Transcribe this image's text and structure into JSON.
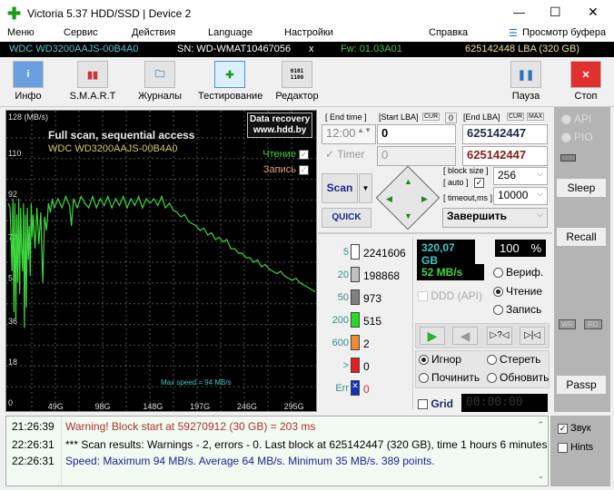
{
  "window": {
    "title": "Victoria 5.37 HDD/SSD | Device 2",
    "minimize": "—",
    "maximize": "☐",
    "close": "✕"
  },
  "menu": [
    "Меню",
    "Сервис",
    "Действия",
    "Language",
    "Настройки",
    "Справка"
  ],
  "buffer_view": "Просмотр буфера",
  "device": {
    "model": "WDC WD3200AAJS-00B4A0",
    "serial": "SN: WD-WMAT10467056",
    "x": "x",
    "firmware": "Fw: 01.03A01",
    "capacity": "625142448 LBA (320 GB)"
  },
  "toolbar": {
    "info": "Инфо",
    "smart": "S.M.A.R.T",
    "logs": "Журналы",
    "testing": "Тестирование",
    "editor": "Редактор",
    "pause": "Пауза",
    "stop": "Стоп"
  },
  "chart_data": {
    "type": "line",
    "title": "Full scan, sequential access",
    "subtitle": "WDC WD3200AAJS-00B4A0",
    "ylabel": "128 (MB/s)",
    "yticks": [
      "110",
      "92",
      "73",
      "55",
      "36",
      "18",
      "0"
    ],
    "xticks": [
      "49G",
      "98G",
      "148G",
      "197G",
      "246G",
      "295G"
    ],
    "ylim": [
      0,
      128
    ],
    "xlim": [
      0,
      320
    ],
    "grid": true,
    "badge": [
      "Data recovery",
      "www.hdd.by"
    ],
    "legend": [
      {
        "label": "Чтение",
        "checked": true,
        "color": "#3ed63e"
      },
      {
        "label": "Запись",
        "checked": true,
        "color": "#e0a080"
      }
    ],
    "annotation": "Max speed = 94 MB/s",
    "series": [
      {
        "name": "Чтение",
        "color": "#3ed63e",
        "points": [
          [
            0,
            90
          ],
          [
            2,
            88
          ],
          [
            4,
            60
          ],
          [
            5,
            92
          ],
          [
            6,
            42
          ],
          [
            7,
            90
          ],
          [
            8,
            38
          ],
          [
            9,
            85
          ],
          [
            10,
            55
          ],
          [
            11,
            92
          ],
          [
            12,
            50
          ],
          [
            13,
            88
          ],
          [
            14,
            70
          ],
          [
            15,
            60
          ],
          [
            16,
            90
          ],
          [
            17,
            35
          ],
          [
            18,
            85
          ],
          [
            19,
            44
          ],
          [
            20,
            88
          ],
          [
            21,
            65
          ],
          [
            22,
            80
          ],
          [
            23,
            58
          ],
          [
            24,
            90
          ],
          [
            25,
            75
          ],
          [
            26,
            85
          ],
          [
            28,
            70
          ],
          [
            30,
            88
          ],
          [
            32,
            72
          ],
          [
            34,
            86
          ],
          [
            36,
            55
          ],
          [
            38,
            84
          ],
          [
            40,
            78
          ],
          [
            42,
            90
          ],
          [
            44,
            86
          ],
          [
            46,
            92
          ],
          [
            48,
            88
          ],
          [
            52,
            92
          ],
          [
            56,
            88
          ],
          [
            60,
            93
          ],
          [
            64,
            89
          ],
          [
            66,
            80
          ],
          [
            68,
            92
          ],
          [
            72,
            88
          ],
          [
            76,
            93
          ],
          [
            80,
            90
          ],
          [
            84,
            88
          ],
          [
            88,
            93
          ],
          [
            92,
            88
          ],
          [
            96,
            92
          ],
          [
            100,
            89
          ],
          [
            104,
            93
          ],
          [
            108,
            88
          ],
          [
            112,
            92
          ],
          [
            116,
            89
          ],
          [
            120,
            93
          ],
          [
            124,
            88
          ],
          [
            128,
            92
          ],
          [
            132,
            89
          ],
          [
            136,
            93
          ],
          [
            140,
            88
          ],
          [
            144,
            92
          ],
          [
            148,
            90
          ],
          [
            152,
            92
          ],
          [
            156,
            89
          ],
          [
            160,
            93
          ],
          [
            164,
            88
          ],
          [
            168,
            90
          ],
          [
            172,
            87
          ],
          [
            176,
            86
          ],
          [
            180,
            84
          ],
          [
            184,
            85
          ],
          [
            188,
            82
          ],
          [
            192,
            81
          ],
          [
            196,
            80
          ],
          [
            200,
            78
          ],
          [
            204,
            79
          ],
          [
            208,
            76
          ],
          [
            212,
            77
          ],
          [
            216,
            74
          ],
          [
            220,
            75
          ],
          [
            224,
            73
          ],
          [
            228,
            74
          ],
          [
            232,
            70
          ],
          [
            236,
            70
          ],
          [
            240,
            68
          ],
          [
            244,
            68
          ],
          [
            248,
            66
          ],
          [
            252,
            66
          ],
          [
            256,
            64
          ],
          [
            260,
            65
          ],
          [
            264,
            62
          ],
          [
            268,
            63
          ],
          [
            272,
            61
          ],
          [
            276,
            60
          ],
          [
            280,
            59
          ],
          [
            284,
            60
          ],
          [
            288,
            58
          ],
          [
            292,
            57
          ],
          [
            296,
            56
          ],
          [
            300,
            57
          ],
          [
            304,
            55
          ],
          [
            308,
            54
          ],
          [
            312,
            53
          ],
          [
            316,
            52
          ],
          [
            320,
            51
          ]
        ]
      }
    ]
  },
  "controls": {
    "end_time_label": "[ End time ]",
    "end_time": "12:00",
    "timer": "Timer",
    "timer_value": "0",
    "start_lba_label": "[Start LBA]",
    "cur": "CUR",
    "zero": "0",
    "start_lba": "0",
    "end_lba_label": "[End LBA]",
    "max": "MAX",
    "end_lba": "625142447",
    "end_lba2": "625142447",
    "scan": "Scan",
    "quick": "QUICK",
    "block_size_label": "[ block size ]",
    "auto_label": "[ auto ]",
    "timeout_label": "[ timeout,ms ]",
    "block_size": "256",
    "timeout": "10000",
    "finish_action": "Завершить"
  },
  "blocks": [
    {
      "ms": "5",
      "count": "2241606",
      "color": "#ffffff"
    },
    {
      "ms": "20",
      "count": "198868",
      "color": "#c0c0c0"
    },
    {
      "ms": "50",
      "count": "973",
      "color": "#808080"
    },
    {
      "ms": "200",
      "count": "515",
      "color": "#22dd22"
    },
    {
      "ms": "600",
      "count": "2",
      "color": "#f08a30"
    },
    {
      "ms": ">",
      "count": "0",
      "color": "#e02020"
    },
    {
      "ms": "Err",
      "count": "0",
      "color": "#1030c0"
    }
  ],
  "status": {
    "position": "320,07 GB",
    "percent": "100",
    "percent_sign": "%",
    "speed": "52 MB/s",
    "ddd": "DDD (API)",
    "timer": "00:00:00",
    "grid": "Grid"
  },
  "modes": {
    "verify": "Вериф.",
    "read": "Чтение",
    "write": "Запись",
    "selected": "read"
  },
  "actions": {
    "ignore": "Игнор",
    "erase": "Стереть",
    "repair": "Починить",
    "refresh": "Обновить",
    "selected": "ignore"
  },
  "side": {
    "api": "API",
    "pio": "PIO",
    "sleep": "Sleep",
    "recall": "Recall",
    "wr": "WR",
    "rd": "RD",
    "passp": "Passp"
  },
  "log": [
    {
      "time": "21:26:39",
      "text": "Warning! Block start at 59270912 (30 GB)  = 203 ms",
      "color": "#b03030"
    },
    {
      "time": "22:26:31",
      "text": "*** Scan results: Warnings - 2, errors - 0. Last block at 625142447 (320 GB), time 1 hours 6 minutes .",
      "color": "#000000"
    },
    {
      "time": "22:26:31",
      "text": "Speed: Maximum 94 MB/s. Average 64 MB/s. Minimum 35 MB/s. 389 points.",
      "color": "#202090"
    }
  ],
  "options": {
    "sound": "Звук",
    "sound_checked": true,
    "hints": "Hints",
    "hints_checked": false
  }
}
